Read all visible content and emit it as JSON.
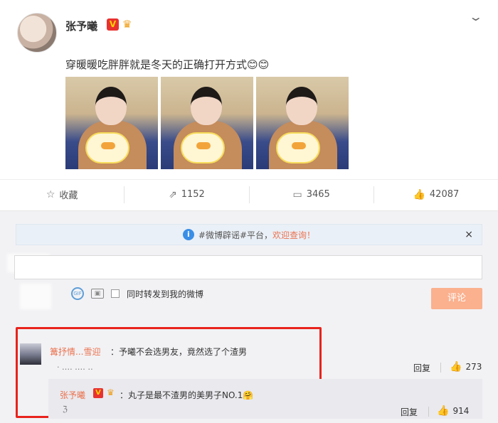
{
  "post": {
    "username": "张予曦",
    "verified_badge": "V",
    "crown_icon": "crown-icon",
    "text": "穿暖暖吃胖胖就是冬天的正确打开方式",
    "emoji": "😊😊"
  },
  "actions": {
    "favorite": "收藏",
    "repost_count": "1152",
    "comment_count": "3465",
    "like_count": "42087"
  },
  "notice": {
    "prefix": "#微博辟谣#平台，",
    "highlight": "欢迎查询！",
    "close": "×"
  },
  "compose": {
    "repost_label": "同时转发到我的微博",
    "submit_label": "评论"
  },
  "comment": {
    "name": "篝抒情...雪迎",
    "text": "：予曦不会选男友，竟然选了个渣男",
    "reply_label": "回复",
    "like_count": "273"
  },
  "subreply": {
    "name": "张予曦",
    "verified_badge": "V",
    "text": "：丸子是最不渣男的美男子NO.1",
    "emoji": "🤗",
    "reply_label": "回复",
    "like_count": "914"
  },
  "colors": {
    "accent": "#eb7350",
    "highlight_box": "#e8231c",
    "verified": "#e8322f"
  }
}
